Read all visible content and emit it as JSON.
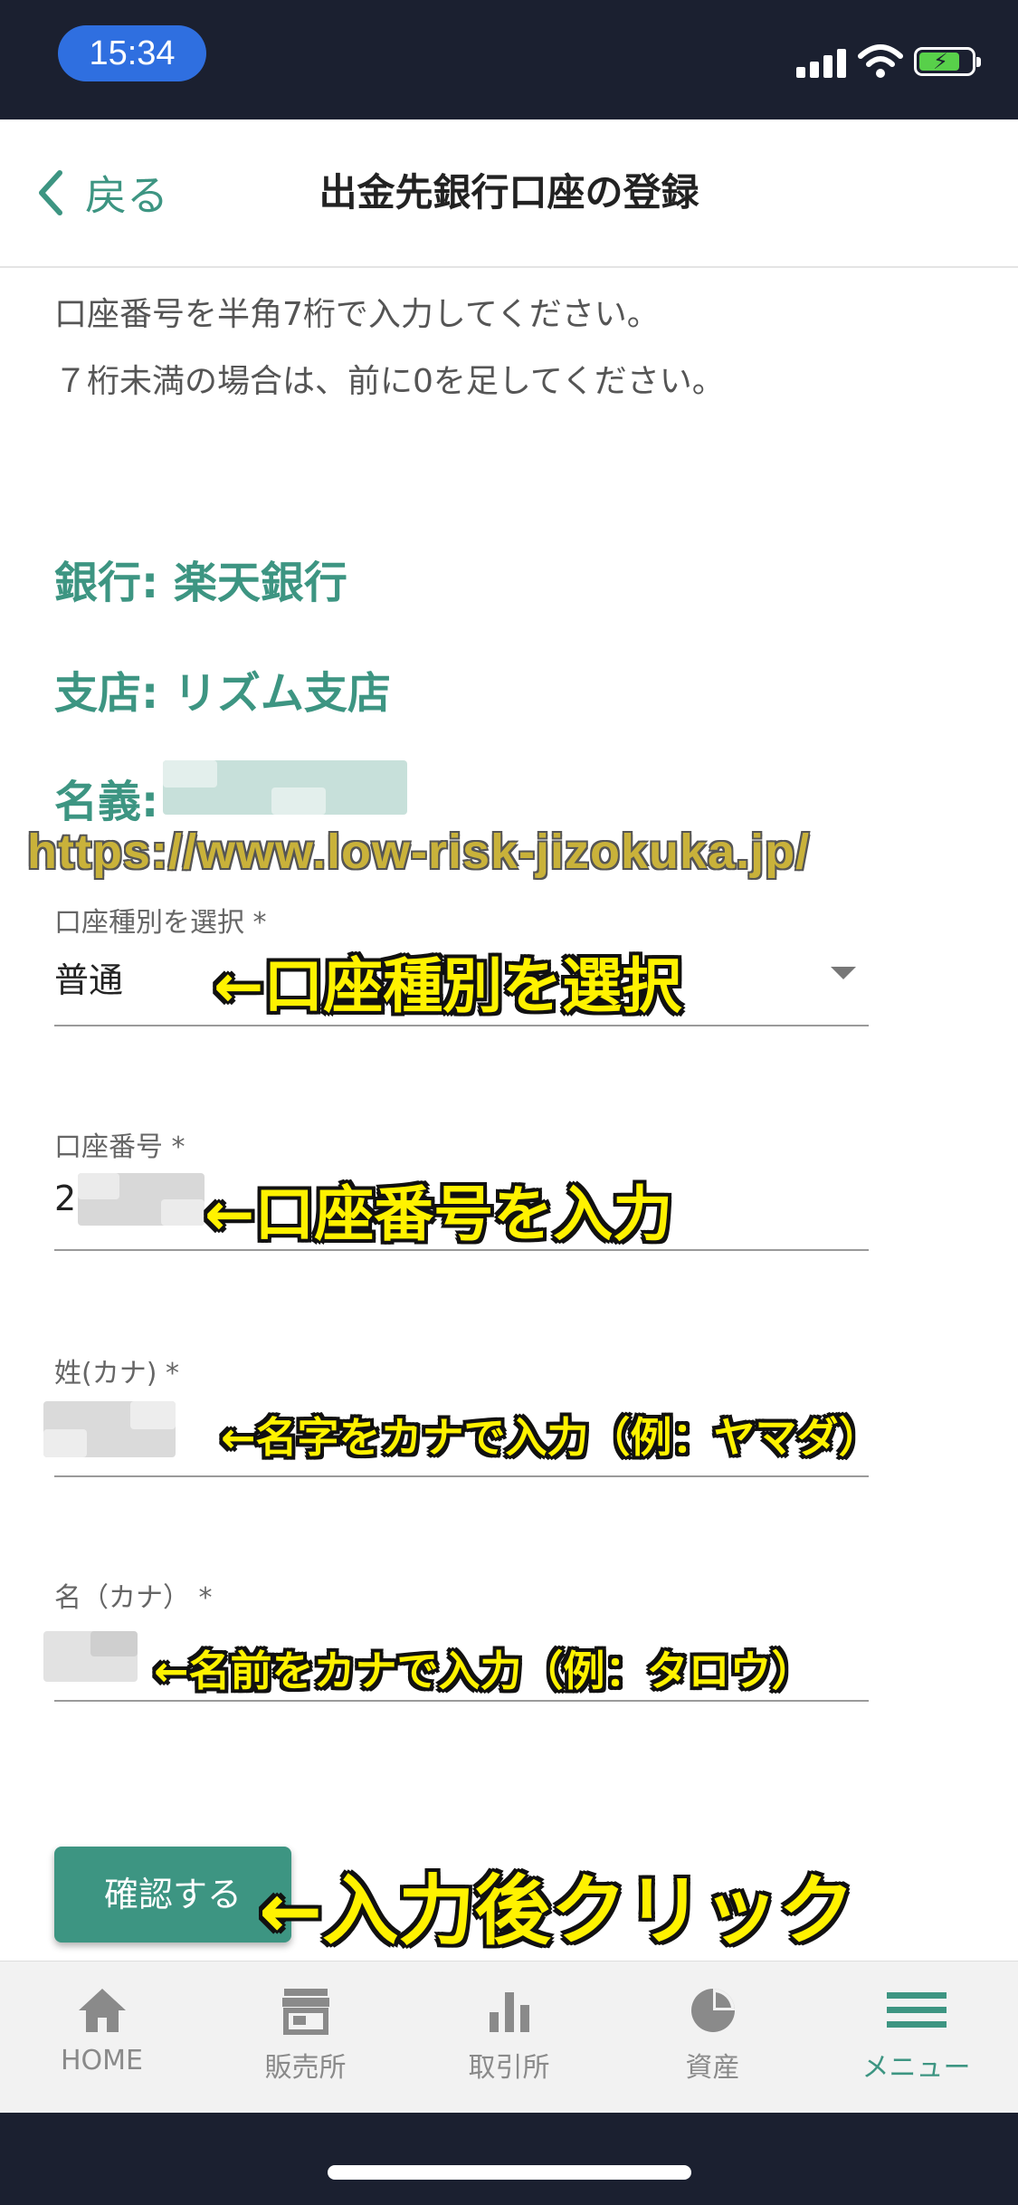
{
  "status_bar": {
    "time": "15:34",
    "accent": "#2f6fe0"
  },
  "nav": {
    "back_label": "戻る",
    "title": "出金先銀行口座の登録"
  },
  "instructions": {
    "line1": "口座番号を半角7桁で入力してください。",
    "line2": "７桁未満の場合は、前に0を足してください。"
  },
  "account_info": {
    "bank": "銀行: 楽天銀行",
    "branch": "支店: リズム支店",
    "holder_label": "名義:"
  },
  "watermark": "https://www.low-risk-jizokuka.jp/",
  "form": {
    "account_type": {
      "label": "口座種別を選択 *",
      "value": "普通"
    },
    "account_number": {
      "label": "口座番号 *",
      "value": "2"
    },
    "last_name": {
      "label": "姓(カナ) *"
    },
    "first_name": {
      "label": "名（カナ） *"
    }
  },
  "annotations": {
    "select_type": "←口座種別を選択",
    "enter_number": "←口座番号を入力",
    "last_name": "←名字をカナで入力（例：ヤマダ）",
    "first_name": "←名前をカナで入力（例：タロウ）",
    "click_after": "←入力後クリック"
  },
  "confirm_button": "確認する",
  "tabs": [
    {
      "label": "HOME",
      "icon": "home-icon"
    },
    {
      "label": "販売所",
      "icon": "store-icon"
    },
    {
      "label": "取引所",
      "icon": "bar-chart-icon"
    },
    {
      "label": "資産",
      "icon": "pie-chart-icon"
    },
    {
      "label": "メニュー",
      "icon": "menu-icon",
      "active": true
    }
  ],
  "colors": {
    "brand": "#3d9582",
    "annotation": "#fff200",
    "status_bar": "#1b2030"
  }
}
